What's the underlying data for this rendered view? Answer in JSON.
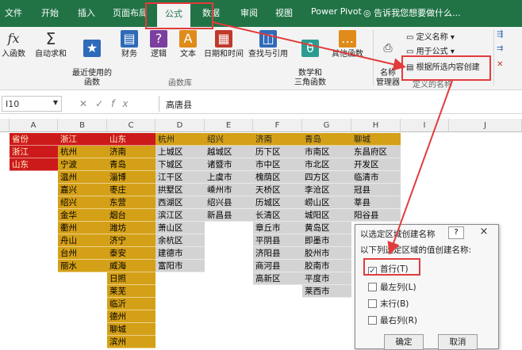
{
  "tabs": [
    {
      "label": "文件",
      "active": false
    },
    {
      "label": "开始",
      "active": false
    },
    {
      "label": "插入",
      "active": false
    },
    {
      "label": "页面布局",
      "active": false
    },
    {
      "label": "公式",
      "active": true
    },
    {
      "label": "数据",
      "active": false
    },
    {
      "label": "审阅",
      "active": false
    },
    {
      "label": "视图",
      "active": false
    },
    {
      "label": "Power Pivot",
      "active": false
    }
  ],
  "tell_me": "告诉我您想要做什么...",
  "ribbon": {
    "buttons": [
      {
        "icon": "fx",
        "label": "入函数"
      },
      {
        "icon": "Σ",
        "label": "自动求和"
      },
      {
        "icon": "★",
        "label": "最近使用的\n函数"
      },
      {
        "icon": "▤",
        "label": "财务"
      },
      {
        "icon": "?",
        "label": "逻辑"
      },
      {
        "icon": "A",
        "label": "文本"
      },
      {
        "icon": "▦",
        "label": "日期和时间"
      },
      {
        "icon": "◫",
        "label": "查找与引用"
      },
      {
        "icon": "θ",
        "label": "数学和\n三角函数"
      },
      {
        "icon": "…",
        "label": "其他函数"
      }
    ],
    "function_library": "函数库",
    "name_manager": "名称\n管理器",
    "define_name": "定义名称",
    "use_in_formula": "用于公式",
    "create_from_selection": "根据所选内容创建",
    "defined_names": "定义的名称"
  },
  "formula_bar": {
    "name_box": "I10",
    "fx": "fx",
    "content": "高唐县"
  },
  "columns": [
    "A",
    "B",
    "C",
    "D",
    "E",
    "F",
    "G",
    "H",
    "I",
    "J"
  ],
  "col_a": [
    "省份",
    "浙江",
    "山东"
  ],
  "col_b": [
    "浙江",
    "杭州",
    "宁波",
    "温州",
    "嘉兴",
    "绍兴",
    "金华",
    "衢州",
    "舟山",
    "台州",
    "丽水"
  ],
  "col_c": [
    "山东",
    "济南",
    "青岛",
    "淄博",
    "枣庄",
    "东营",
    "烟台",
    "潍坊",
    "济宁",
    "泰安",
    "威海",
    "日照",
    "莱芜",
    "临沂",
    "德州",
    "聊城",
    "滨州"
  ],
  "col_d": [
    "杭州",
    "上城区",
    "下城区",
    "江干区",
    "拱墅区",
    "西湖区",
    "滨江区",
    "萧山区",
    "余杭区",
    "建德市",
    "富阳市"
  ],
  "col_e": [
    "绍兴",
    "越城区",
    "诸暨市",
    "上虞市",
    "嵊州市",
    "绍兴县",
    "新昌县"
  ],
  "col_f": [
    "济南",
    "历下区",
    "市中区",
    "槐荫区",
    "天桥区",
    "历城区",
    "长清区",
    "章丘市",
    "平阴县",
    "济阳县",
    "商河县",
    "高新区"
  ],
  "col_g": [
    "青岛",
    "市南区",
    "市北区",
    "四方区",
    "李沧区",
    "崂山区",
    "城阳区",
    "黄岛区",
    "即墨市",
    "胶州市",
    "胶南市",
    "平度市",
    "莱西市"
  ],
  "col_h": [
    "聊城",
    "东昌府区",
    "开发区",
    "临清市",
    "冠县",
    "莘县",
    "阳谷县"
  ],
  "dialog": {
    "title": "以选定区域创建名称",
    "help": "?",
    "close": "×",
    "prompt": "以下列选定区域的值创建名称:",
    "options": [
      {
        "label": "首行(T)",
        "checked": true
      },
      {
        "label": "最左列(L)",
        "checked": false
      },
      {
        "label": "末行(B)",
        "checked": false
      },
      {
        "label": "最右列(R)",
        "checked": false
      }
    ],
    "ok": "确定",
    "cancel": "取消"
  },
  "colors": {
    "excel_green": "#217346",
    "gold": "#d4a017",
    "gray": "#d3d3d3",
    "red": "#cc1a1a",
    "annotation": "#e23b3b"
  }
}
